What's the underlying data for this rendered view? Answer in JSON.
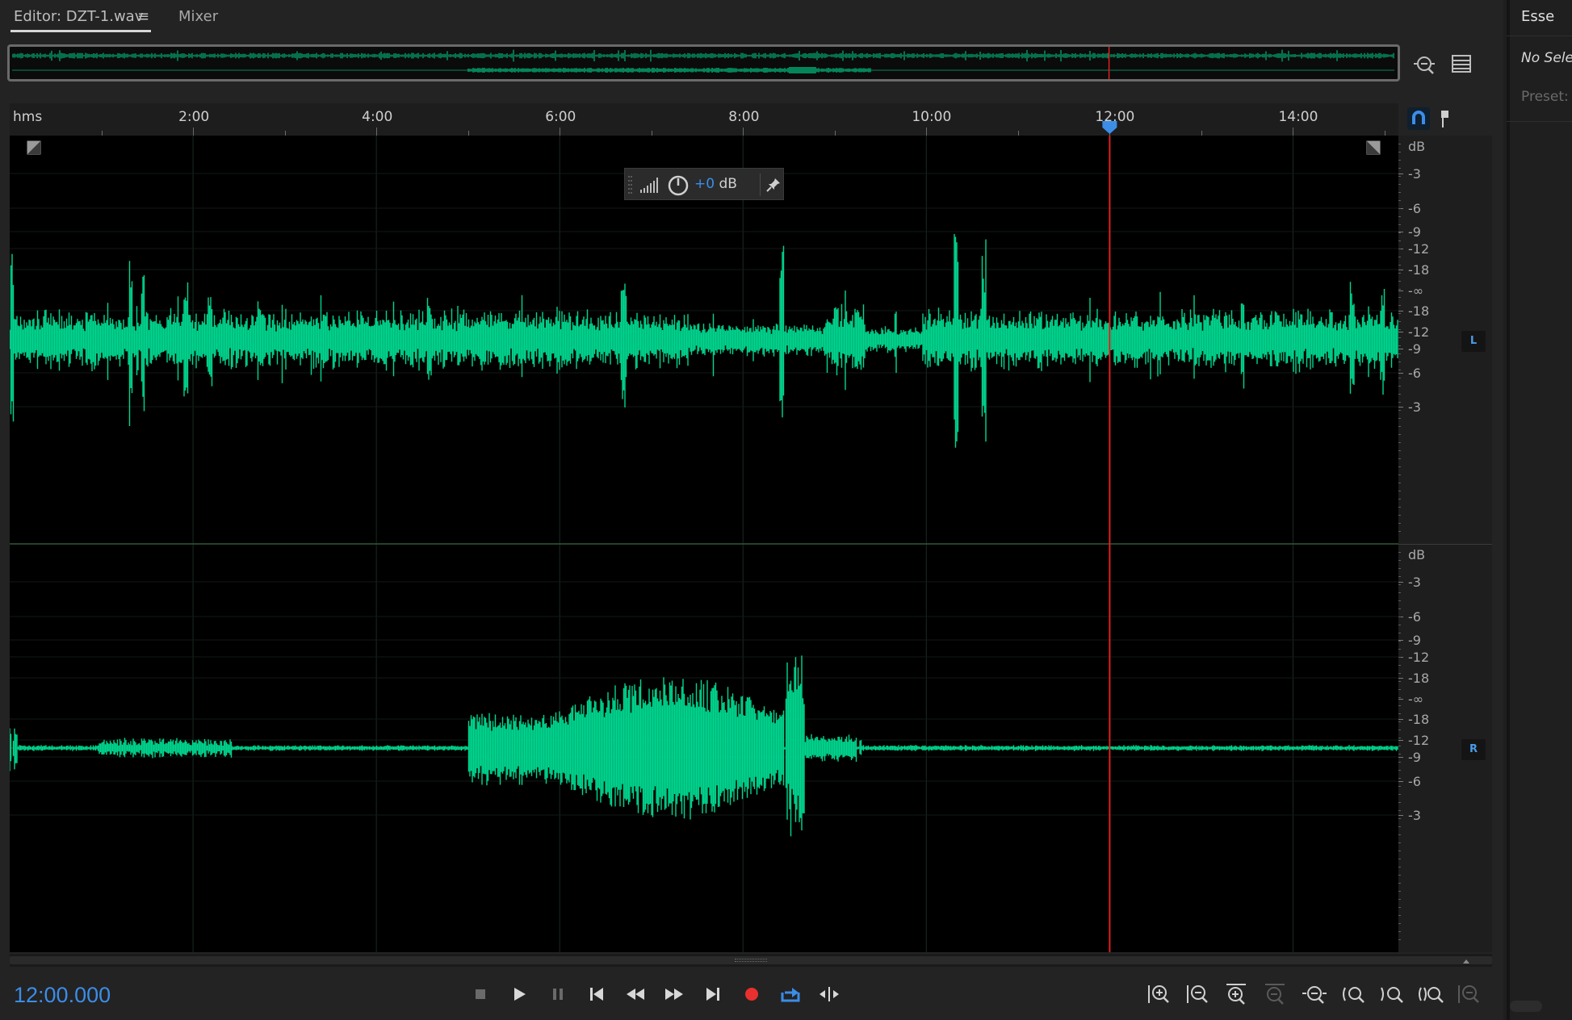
{
  "tabs": {
    "editor_label": "Editor: DZT-1.wav",
    "menu_glyph": "≡",
    "mixer_label": "Mixer"
  },
  "ruler": {
    "unit_label": "hms",
    "time_labels": [
      "2:00",
      "4:00",
      "6:00",
      "8:00",
      "10:00",
      "12:00",
      "14:00"
    ]
  },
  "hud": {
    "gain_value": "+0",
    "gain_unit": " dB"
  },
  "db_scale": {
    "unit": "dB",
    "labels_upper": [
      "-3",
      "-6",
      "-9",
      "-12",
      "-18",
      "-∞",
      "-18",
      "-12",
      "-9",
      "-6",
      "-3"
    ],
    "labels_lower": [
      "-3",
      "-6",
      "-9",
      "-12",
      "-18",
      "-∞",
      "-18",
      "-12",
      "-9",
      "-6",
      "-3"
    ]
  },
  "channels": {
    "left_badge": "L",
    "right_badge": "R"
  },
  "playhead": {
    "time": "12:00.000",
    "position_minutes": 12,
    "total_minutes": 15.15
  },
  "transport": {
    "buttons": [
      "stop-icon",
      "play-icon",
      "pause-icon",
      "skip-to-start-icon",
      "rewind-icon",
      "fast-forward-icon",
      "skip-to-end-icon",
      "record-icon",
      "loop-playback-icon",
      "skip-selection-icon"
    ]
  },
  "zoom_controls": {
    "buttons": [
      "zoom-in-amplitude-icon",
      "zoom-out-amplitude-icon",
      "zoom-in-time-icon",
      "zoom-out-time-icon",
      "zoom-out-full-icon",
      "zoom-in-selection-start-icon",
      "zoom-in-selection-end-icon",
      "zoom-to-selection-icon",
      "zoom-in-channels-icon"
    ]
  },
  "right_panel": {
    "title": "Esse",
    "no_selection": "No Selec",
    "preset_label": "Preset:"
  },
  "colors": {
    "waveform": "#00d68f",
    "playhead": "#e02020",
    "accent": "#3b8de8",
    "record": "#e8302e"
  }
}
